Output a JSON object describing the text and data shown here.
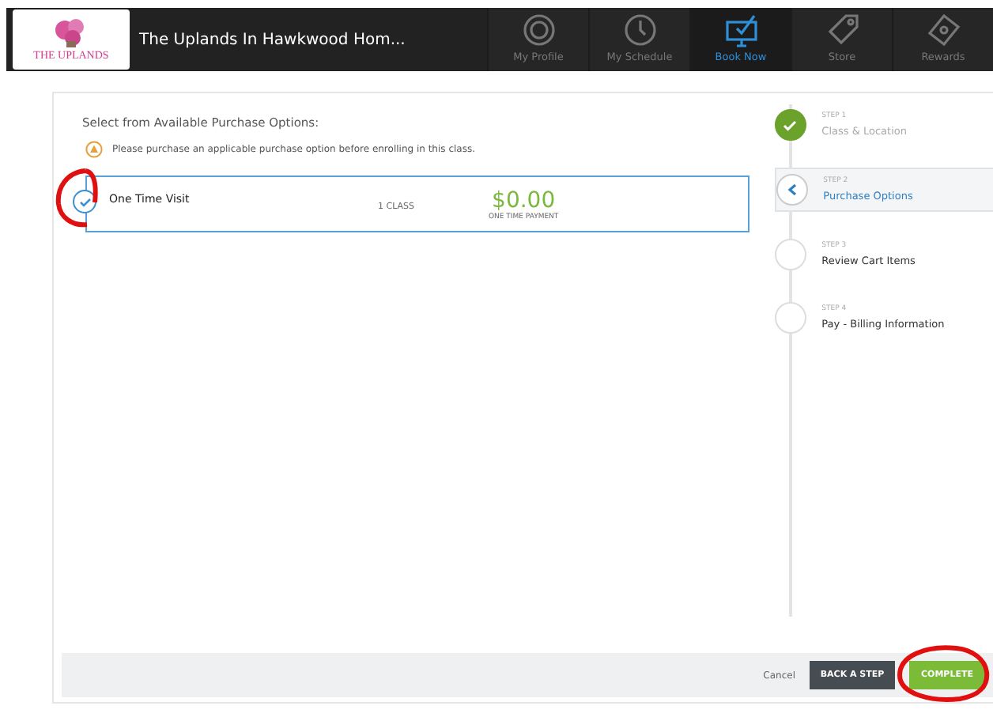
{
  "header": {
    "logo": "THE UPLANDS",
    "title": "The Uplands In Hawkwood Hom...",
    "nav": [
      {
        "label": "My Profile",
        "selected": false
      },
      {
        "label": "My Schedule",
        "selected": false
      },
      {
        "label": "Book Now",
        "selected": true
      },
      {
        "label": "Store",
        "selected": false
      },
      {
        "label": "Rewards",
        "selected": false
      }
    ]
  },
  "heading": "Select from Available Purchase Options:",
  "notice": "Please purchase an applicable purchase option before enrolling in this class.",
  "options": [
    {
      "name": "One Time Visit",
      "quantity": "1 CLASS",
      "price": "$0.00",
      "price_note": "ONE TIME PAYMENT",
      "selected": true,
      "circled": true
    }
  ],
  "steps": [
    {
      "step": "STEP 1",
      "label": "Class & Location",
      "completed": true,
      "selected": false
    },
    {
      "step": "STEP 2",
      "label": "Purchase Options",
      "completed": false,
      "selected": true
    },
    {
      "step": "STEP 3",
      "label": "Review Cart Items",
      "completed": false,
      "selected": false
    },
    {
      "step": "STEP 4",
      "label": "Pay - Billing Information",
      "completed": false,
      "selected": false
    }
  ],
  "footer": {
    "cancel": "Cancel",
    "back": "BACK A STEP",
    "complete": "COMPLETE",
    "complete_circled": true
  }
}
